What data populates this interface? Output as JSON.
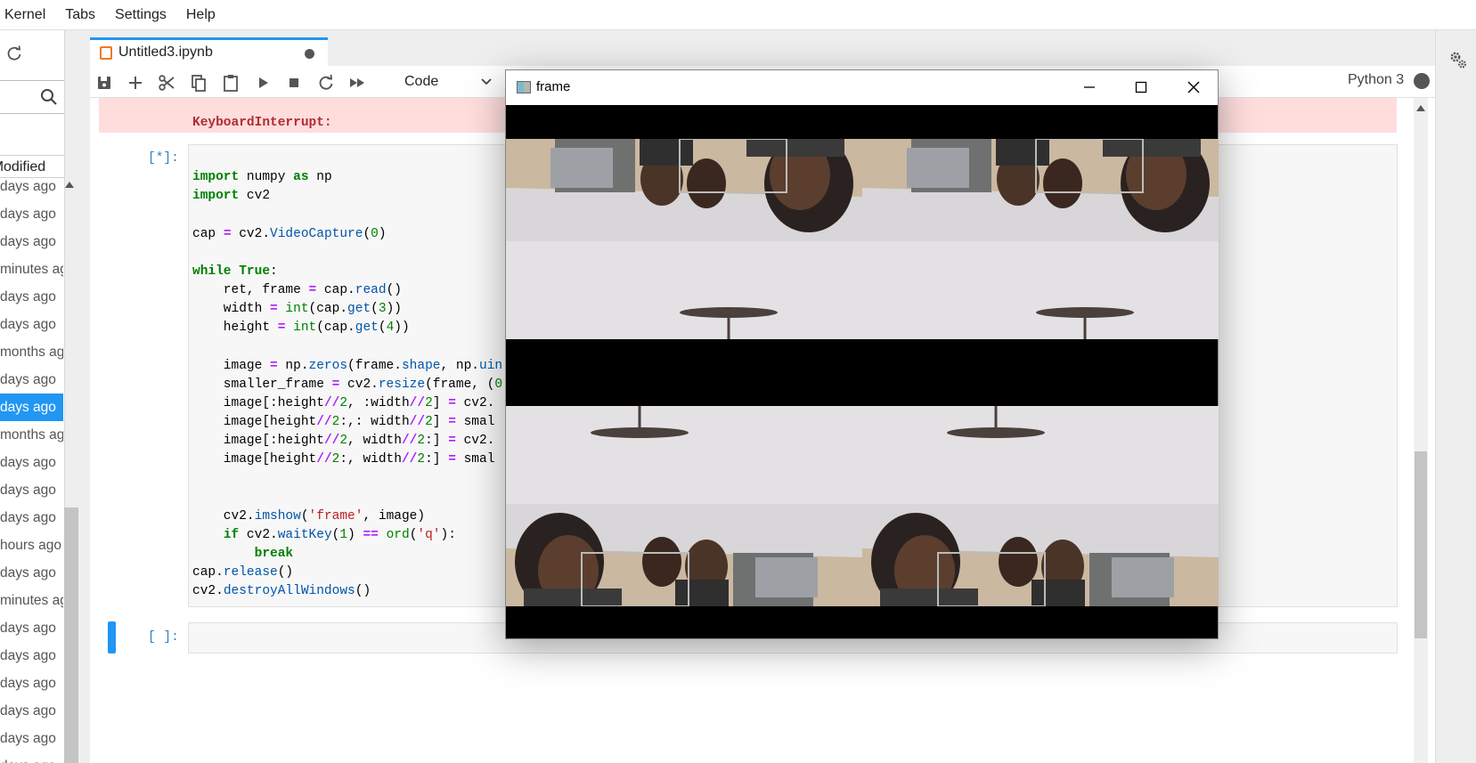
{
  "menu": {
    "items": [
      "Kernel",
      "Tabs",
      "Settings",
      "Help"
    ]
  },
  "file_browser": {
    "column_header": "Last Modified",
    "rows": [
      "days ago",
      "days ago",
      "days ago",
      "minutes ago",
      "days ago",
      "days ago",
      "months ago",
      "days ago",
      "days ago",
      "months ago",
      "days ago",
      "days ago",
      "days ago",
      "hours ago",
      "days ago",
      "minutes ago",
      "days ago",
      "days ago",
      "days ago",
      "days ago",
      "days ago",
      "days ago"
    ],
    "selected_index": 8
  },
  "tab": {
    "title": "Untitled3.ipynb"
  },
  "toolbar": {
    "cell_type": "Code",
    "kernel": "Python 3",
    "icons": [
      "save-icon",
      "add-icon",
      "cut-icon",
      "copy-icon",
      "paste-icon",
      "run-icon",
      "stop-icon",
      "restart-icon",
      "fast-forward-icon"
    ]
  },
  "cells": {
    "error_text": "KeyboardInterrupt:",
    "cell1_prompt": "[*]:",
    "cell2_prompt": "[ ]:"
  },
  "frame_window": {
    "title": "frame"
  },
  "colors": {
    "accent": "#2196f3",
    "error_bg": "#ffdddd",
    "keyword": "#008000",
    "operator": "#aa22ff"
  }
}
